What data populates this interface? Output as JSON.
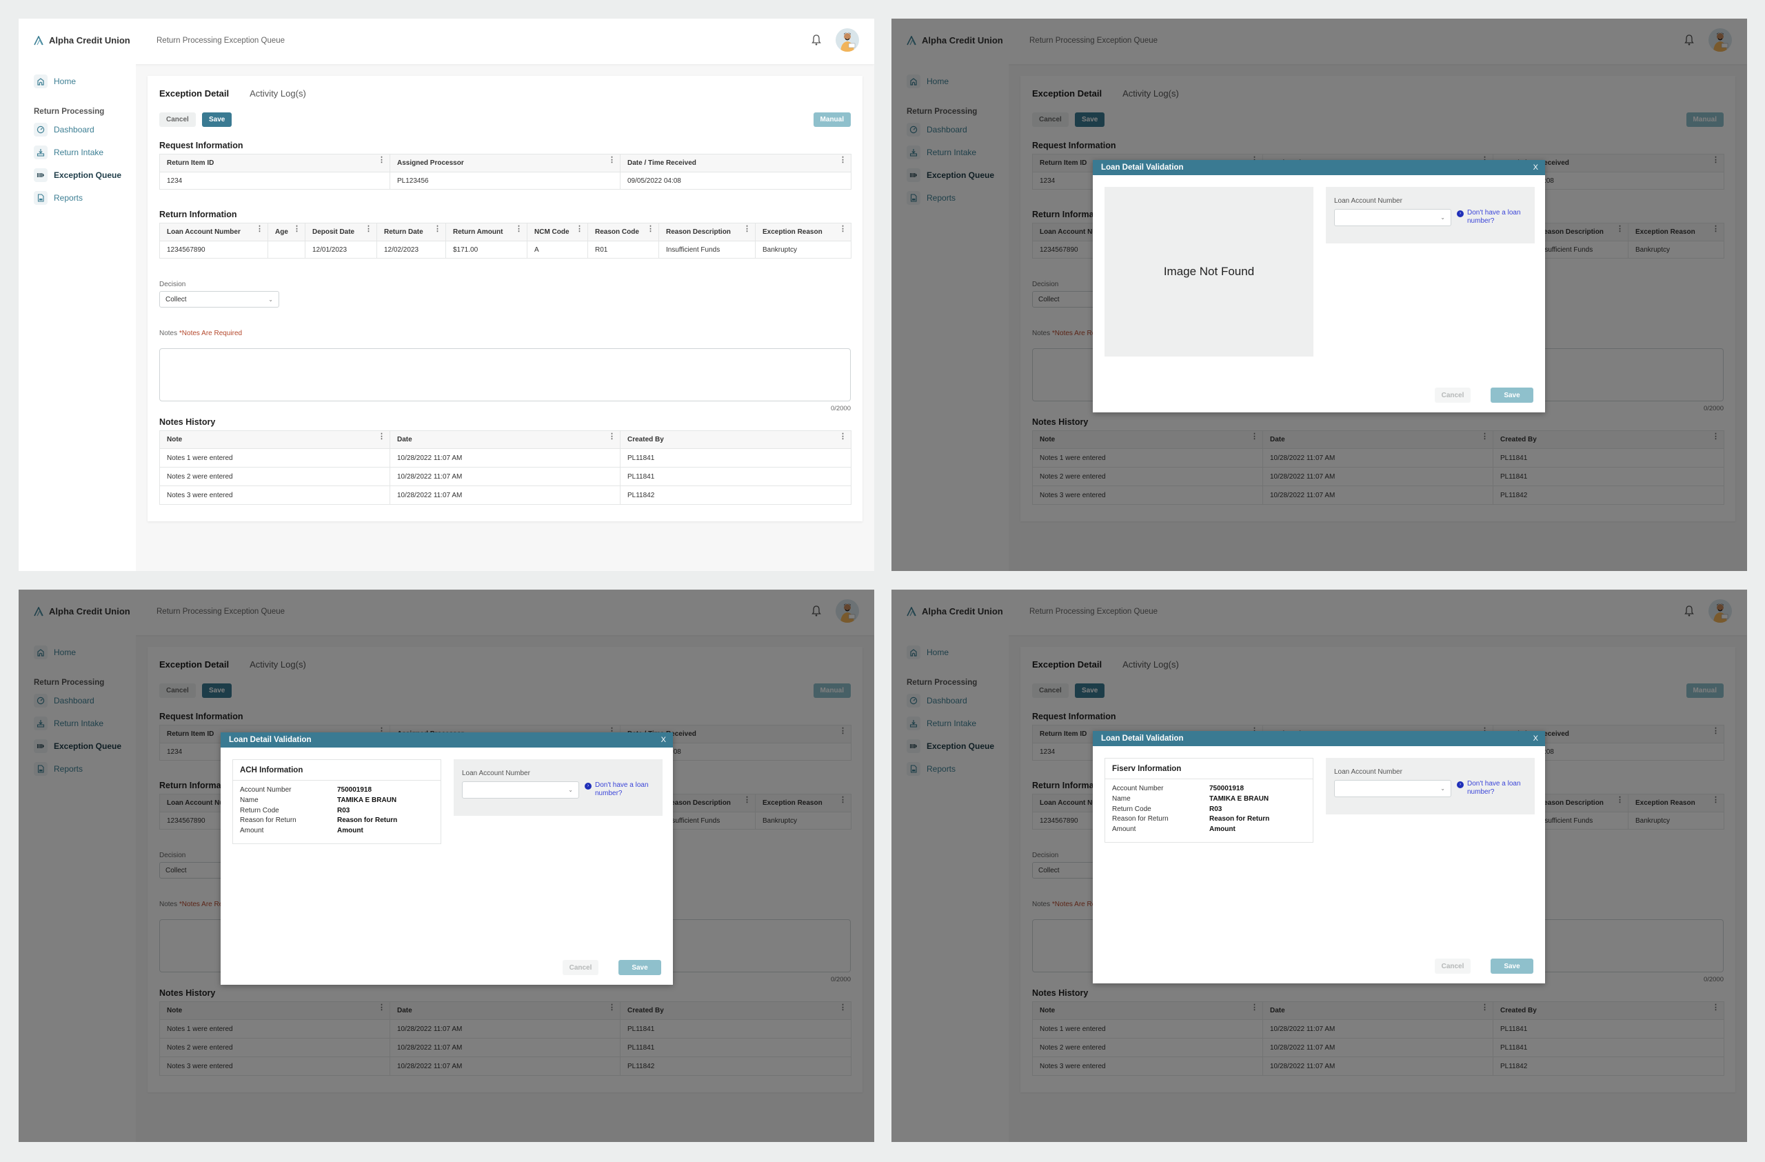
{
  "app": {
    "brand": "Alpha Credit Union",
    "page_title": "Return Processing Exception Queue"
  },
  "sidebar": {
    "home": "Home",
    "section": "Return Processing",
    "items": [
      {
        "label": "Dashboard",
        "icon": "dashboard-icon"
      },
      {
        "label": "Return Intake",
        "icon": "download-tray-icon"
      },
      {
        "label": "Exception Queue",
        "icon": "queue-icon",
        "active": true
      },
      {
        "label": "Reports",
        "icon": "report-icon"
      }
    ]
  },
  "tabs": [
    "Exception Detail",
    "Activity Log(s)"
  ],
  "toolbar": {
    "cancel": "Cancel",
    "save": "Save",
    "manual": "Manual"
  },
  "request_info": {
    "title": "Request Information",
    "columns": [
      "Return Item ID",
      "Assigned Processor",
      "Date / Time Received"
    ],
    "row": [
      "1234",
      "PL123456",
      "09/05/2022 04:08"
    ]
  },
  "return_info": {
    "title": "Return Information",
    "columns": [
      "Loan Account Number",
      "Age",
      "Deposit Date",
      "Return Date",
      "Return Amount",
      "NCM Code",
      "Reason Code",
      "Reason Description",
      "Exception Reason"
    ],
    "row": [
      "1234567890",
      "",
      "12/01/2023",
      "12/02/2023",
      "$171.00",
      "A",
      "R01",
      "Insufficient Funds",
      "Bankruptcy"
    ]
  },
  "decision": {
    "label": "Decision",
    "value": "Collect"
  },
  "notes": {
    "label": "Notes",
    "required": "*Notes Are Required",
    "value": "",
    "counter": "0/2000"
  },
  "notes_history": {
    "title": "Notes History",
    "columns": [
      "Note",
      "Date",
      "Created By"
    ],
    "rows": [
      [
        "Notes 1 were entered",
        "10/28/2022 11:07 AM",
        "PL11841"
      ],
      [
        "Notes 2 were entered",
        "10/28/2022 11:07 AM",
        "PL11841"
      ],
      [
        "Notes 3 were entered",
        "10/28/2022 11:07 AM",
        "PL11842"
      ]
    ]
  },
  "modal": {
    "title": "Loan Detail Validation",
    "close": "X",
    "image_not_found": "Image Not Found",
    "loan_label": "Loan Account Number",
    "loan_value": "",
    "no_loan_link": "Don't have a loan number?",
    "cancel": "Cancel",
    "save": "Save",
    "ach": {
      "title": "ACH Information",
      "rows": [
        [
          "Account Number",
          "750001918"
        ],
        [
          "Name",
          "TAMIKA E BRAUN"
        ],
        [
          "Return Code",
          "R03"
        ],
        [
          "Reason for Return",
          "Reason for Return"
        ],
        [
          "Amount",
          "Amount"
        ]
      ]
    },
    "fiserv": {
      "title": "Fiserv Information",
      "rows": [
        [
          "Account Number",
          "750001918"
        ],
        [
          "Name",
          "TAMIKA E BRAUN"
        ],
        [
          "Return Code",
          "R03"
        ],
        [
          "Reason for Return",
          "Reason for Return"
        ],
        [
          "Amount",
          "Amount"
        ]
      ]
    }
  },
  "colors": {
    "accent": "#3a7a92",
    "link": "#3b45d8",
    "required": "#b4482c",
    "manual": "#8fc0cc"
  }
}
